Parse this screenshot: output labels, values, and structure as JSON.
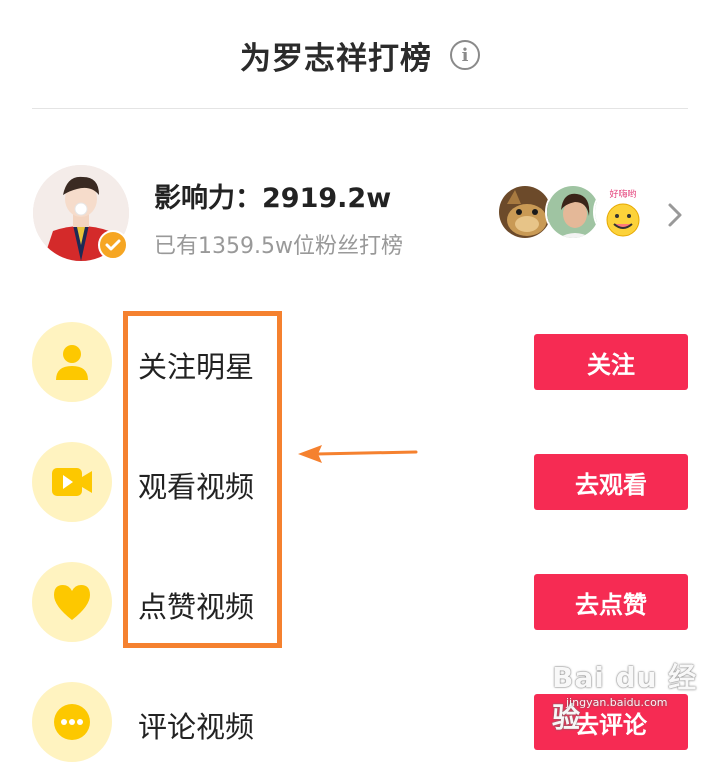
{
  "header": {
    "title": "为罗志祥打榜",
    "info_icon": "info-icon"
  },
  "star": {
    "influence": "影响力：2919.2w",
    "fan_count": "已有1359.5w位粉丝打榜"
  },
  "tasks": [
    {
      "label": "关注明星",
      "button": "关注",
      "icon": "person-icon"
    },
    {
      "label": "观看视频",
      "button": "去观看",
      "icon": "video-camera-icon"
    },
    {
      "label": "点赞视频",
      "button": "去点赞",
      "icon": "heart-icon"
    },
    {
      "label": "评论视频",
      "button": "去评论",
      "icon": "comment-icon"
    }
  ],
  "colors": {
    "accent": "#f62b53",
    "icon_bg": "#fff3c0",
    "icon_fg": "#fdc800",
    "highlight": "#f5812f"
  },
  "fan_sticker_text": "好嗨哟",
  "watermark": {
    "logo": "Bai du 经验",
    "url": "jingyan.baidu.com"
  }
}
